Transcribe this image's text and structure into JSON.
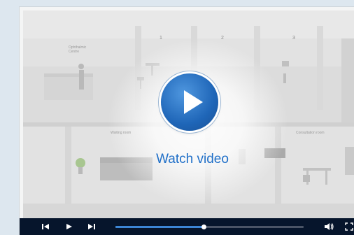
{
  "scene": {
    "room_numbers": [
      "1",
      "2",
      "3"
    ],
    "reception_label_line1": "Ophthalmic",
    "reception_label_line2": "Centre",
    "waiting_room_label": "Waiting room",
    "consultation_room_label": "Consultation room"
  },
  "overlay": {
    "watch_label": "Watch video",
    "play_icon": "play-icon"
  },
  "controls": {
    "skip_back_icon": "skip-back-icon",
    "play_icon": "play-icon",
    "skip_forward_icon": "skip-forward-icon",
    "volume_icon": "volume-icon",
    "fullscreen_icon": "fullscreen-icon",
    "progress_fraction": 0.47
  },
  "colors": {
    "accent": "#1f6fc8",
    "controls_bg": "#06152c",
    "progress_fill": "#3c86d6"
  }
}
